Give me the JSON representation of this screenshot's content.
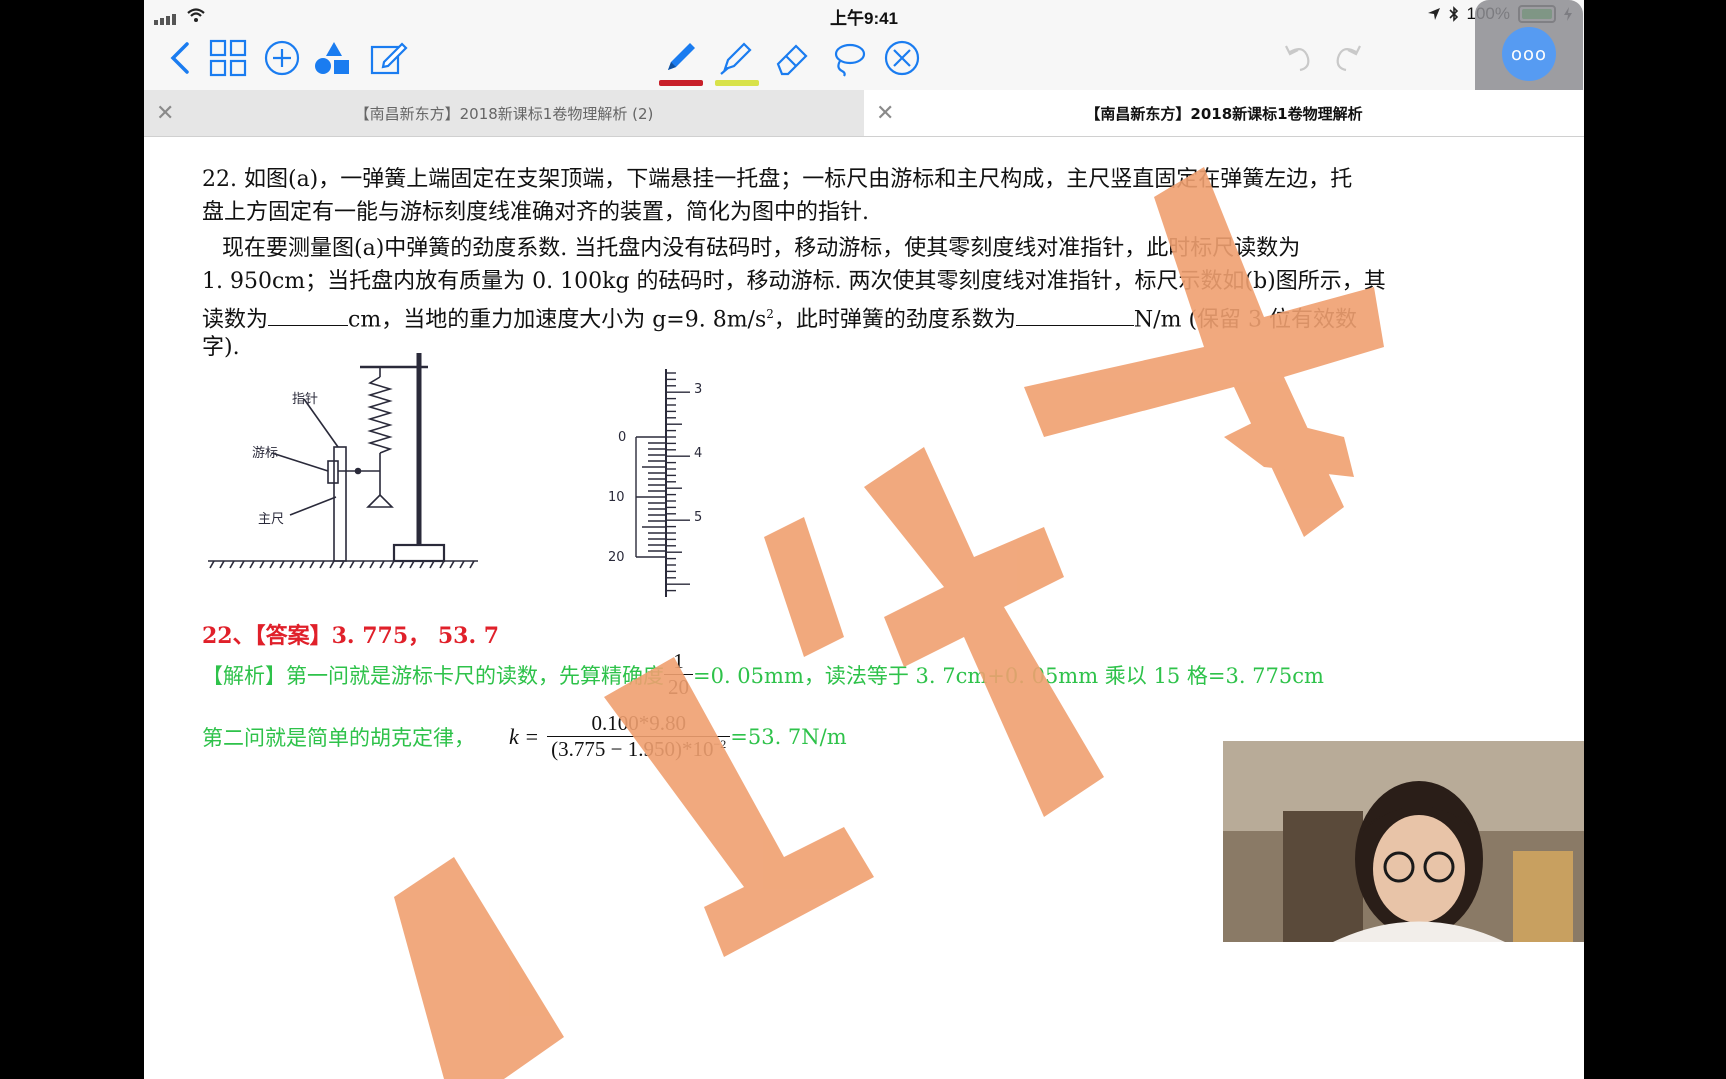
{
  "status_bar": {
    "time": "上午9:41",
    "battery": "100%"
  },
  "toolbar": {
    "pen_color": "#c8202a",
    "highlighter_color": "#d8e24a",
    "more_label": "ooo"
  },
  "tabs": [
    {
      "label": "【南昌新东方】2018新课标1卷物理解析 (2)",
      "active": false
    },
    {
      "label": "【南昌新东方】2018新课标1卷物理解析",
      "active": true
    }
  ],
  "question": {
    "line1": "22. 如图(a)，一弹簧上端固定在支架顶端，下端悬挂一托盘；一标尺由游标和主尺构成，主尺竖直固定在弹簧左边，托",
    "line2": "盘上方固定有一能与游标刻度线准确对齐的装置，简化为图中的指针.",
    "line3": "现在要测量图(a)中弹簧的劲度系数. 当托盘内没有砝码时，移动游标，使其零刻度线对准指针，此时标尺读数为",
    "line4": "1. 950cm；当托盘内放有质量为 0. 100kg 的砝码时，移动游标. 两次使其零刻度线对准指针，标尺示数如(b)图所示，其",
    "line5_a": "读数为",
    "line5_b": "cm，当地的重力加速度大小为 g=9. 8m/s",
    "line5_sup": "2",
    "line5_c": "，此时弹簧的劲度系数为",
    "line5_d": "N/m (保留 3 位有效数",
    "line6": "字)."
  },
  "figure_a": {
    "pointer_label": "指针",
    "vernier_label": "游标",
    "main_scale_label": "主尺"
  },
  "figure_b": {
    "main_labels": [
      "3",
      "4",
      "5"
    ],
    "vernier_labels": [
      "0",
      "10",
      "20"
    ]
  },
  "answer": {
    "text": "22、【答案】3. 775，  53. 7"
  },
  "explanation": {
    "line1_a": "【解析】第一问就是游标卡尺的读数，先算精确度",
    "frac1_num": "1",
    "frac1_den": "20",
    "line1_b": "=0. 05mm，读法等于 3. 7cm+0. 05mm 乘以 15 格=3. 775cm",
    "line2_a": "第二问就是简单的胡克定律，",
    "k_eq": "k =",
    "frac2_num": "0.100*9.80",
    "frac2_den": "(3.775 − 1.950)*10",
    "frac2_den_sup": "−2",
    "line2_b": "=53. 7N/m"
  },
  "watermark": {
    "color": "#f0a070"
  }
}
